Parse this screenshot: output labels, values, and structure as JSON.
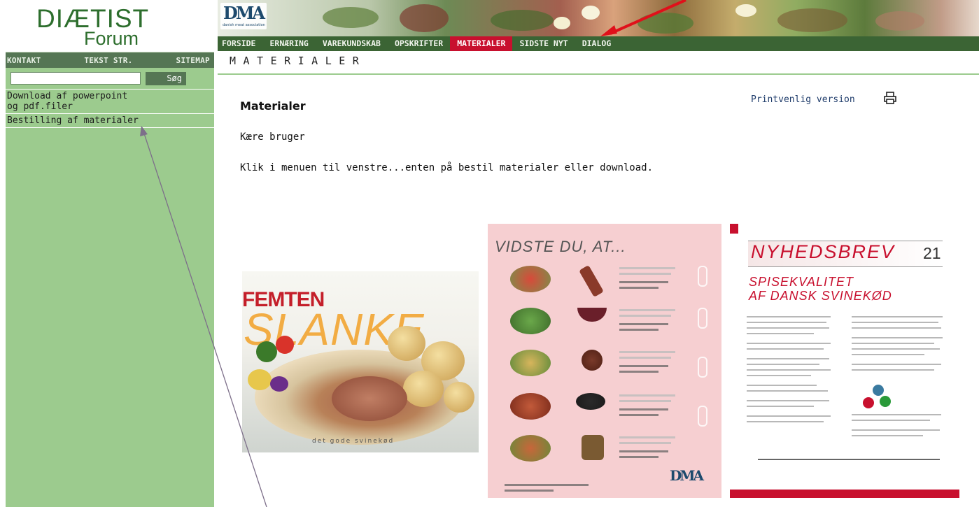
{
  "logo": {
    "line1": "DIÆTIST",
    "line2": "Forum"
  },
  "top_links": [
    "KONTAKT",
    "TEKST STR.",
    "SITEMAP"
  ],
  "search": {
    "placeholder": "",
    "button": "Søg"
  },
  "sidebar_items": [
    "Download af powerpoint",
    "og pdf.filer",
    "Bestilling af materialer"
  ],
  "banner": {
    "org_mark": "DMA",
    "org_name": "danish meat association"
  },
  "nav": [
    "FORSIDE",
    "ERNÆRING",
    "VAREKUNDSKAB",
    "OPSKRIFTER",
    "MATERIALER",
    "SIDSTE NYT",
    "DIALOG"
  ],
  "nav_active": "MATERIALER",
  "section_title": "MATERIALER",
  "content": {
    "title": "Materialer",
    "print_link": "Printvenlig version",
    "greeting": "Kære bruger",
    "instruction": "Klik i menuen til venstre...enten på bestil materialer eller download."
  },
  "brochures": [
    {
      "title_top": "FEMTEN",
      "title_main": "SLANKE",
      "tagline": "det gode svinekød"
    },
    {
      "title": "VIDSTE DU, AT...",
      "logo": "DMA"
    },
    {
      "title": "NYHEDSBREV",
      "issue": "21",
      "subtitle_line1": "SPISEKVALITET",
      "subtitle_line2": "AF DANSK SVINEKØD"
    }
  ],
  "colors": {
    "sidebar": "#9ccb8e",
    "nav_bar": "#3b6434",
    "nav_active": "#c8102e",
    "annotation_arrow_red": "#e0101a",
    "annotation_line": "#7d6f8a"
  }
}
